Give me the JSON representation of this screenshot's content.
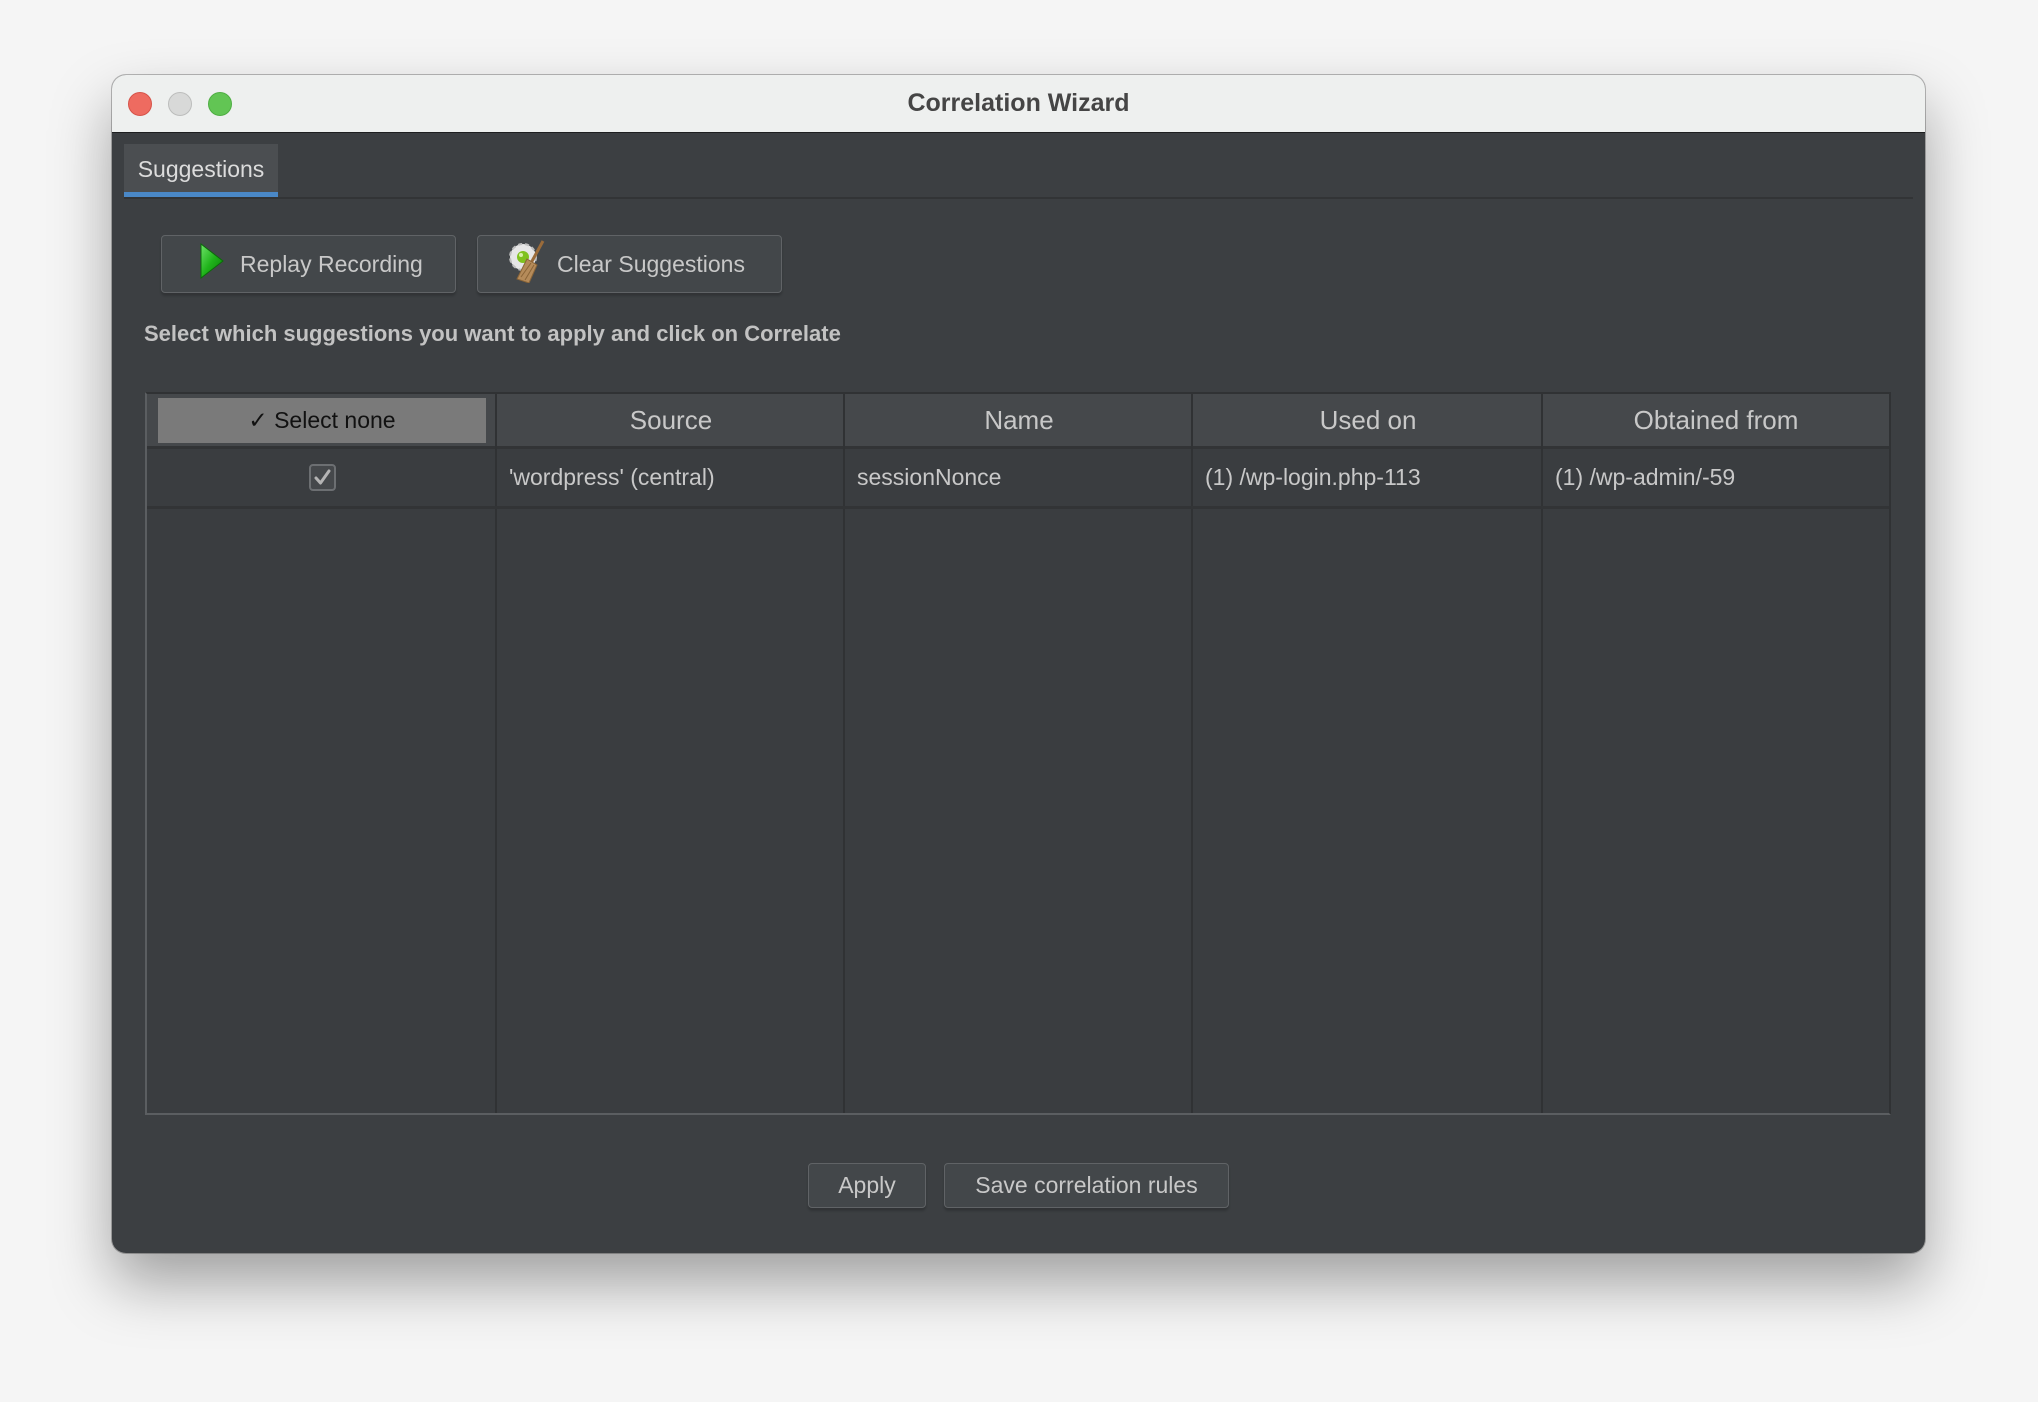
{
  "window": {
    "title": "Correlation Wizard",
    "controls": [
      "close",
      "minimize",
      "zoom"
    ]
  },
  "tabs": [
    {
      "label": "Suggestions",
      "active": true
    }
  ],
  "toolbar": {
    "replay_label": "Replay Recording",
    "replay_icon": "play-icon",
    "clear_label": "Clear Suggestions",
    "clear_icon": "broom-gear-icon"
  },
  "instruction": "Select which suggestions you want to apply and click on Correlate",
  "table": {
    "select_none_label": "✓ Select none",
    "columns": [
      "Source",
      "Name",
      "Used on",
      "Obtained from"
    ],
    "rows": [
      {
        "checked": true,
        "source": "'wordpress' (central)",
        "name": "sessionNonce",
        "used_on": "(1) /wp-login.php-113",
        "obtained_from": "(1) /wp-admin/-59"
      }
    ]
  },
  "footer": {
    "apply_label": "Apply",
    "save_label": "Save correlation rules"
  },
  "colors": {
    "accent_tab_underline": "#4a88c7",
    "window_bg": "#3c3f42",
    "titlebar_bg": "#eef0ef"
  }
}
